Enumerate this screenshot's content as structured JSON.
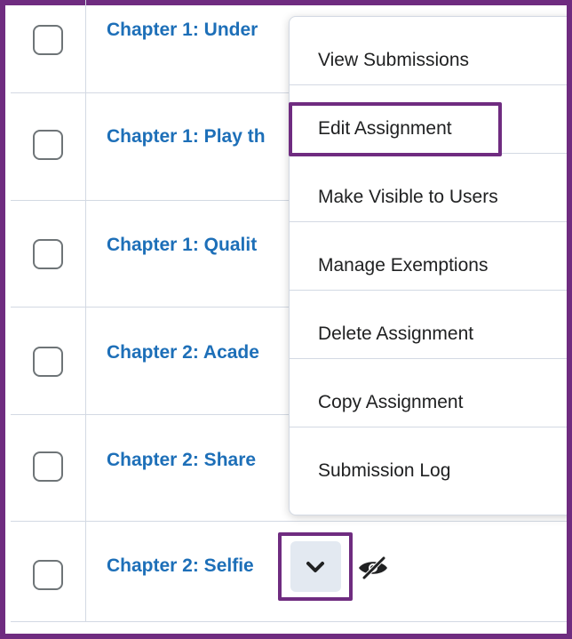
{
  "rows": [
    {
      "title": "Chapter 1: Under"
    },
    {
      "title": "Chapter 1: Play th"
    },
    {
      "title": "Chapter 1: Qualit"
    },
    {
      "title": "Chapter 2: Acade"
    },
    {
      "title": "Chapter 2: Share"
    },
    {
      "title": "Chapter 2: Selfie"
    }
  ],
  "menu": {
    "items": [
      {
        "label": "View Submissions"
      },
      {
        "label": "Edit Assignment"
      },
      {
        "label": "Make Visible to Users"
      },
      {
        "label": "Manage Exemptions"
      },
      {
        "label": "Delete Assignment"
      },
      {
        "label": "Copy Assignment"
      },
      {
        "label": "Submission Log"
      }
    ]
  },
  "icons": {
    "row_action": "chevron-down-icon",
    "visibility": "eye-slash-icon"
  },
  "colors": {
    "highlight": "#6f2c80",
    "link": "#1d6fb8"
  }
}
